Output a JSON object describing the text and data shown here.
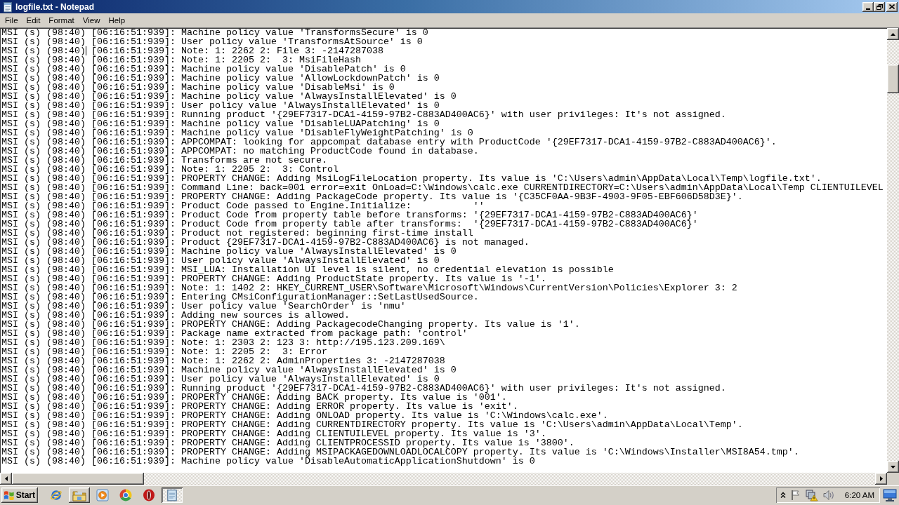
{
  "window": {
    "title": "logfile.txt - Notepad"
  },
  "menu": [
    "File",
    "Edit",
    "Format",
    "View",
    "Help"
  ],
  "editor": {
    "lines": [
      {
        "text": "MSI (s) (98:40) [06:16:51:939]: Machine policy value 'TransformsSecure' is 0",
        "caret": false
      },
      {
        "text": "MSI (s) (98:40) [06:16:51:939]: User policy value 'TransformsAtSource' is 0",
        "caret": false
      },
      {
        "text": "MSI (s) (98:40) [06:16:51:939]: Note: 1: 2262 2: File 3: -2147287038",
        "caret": true
      },
      {
        "text": "MSI (s) (98:40) [06:16:51:939]: Note: 1: 2205 2:  3: MsiFileHash",
        "caret": false
      },
      {
        "text": "MSI (s) (98:40) [06:16:51:939]: Machine policy value 'DisablePatch' is 0",
        "caret": false
      },
      {
        "text": "MSI (s) (98:40) [06:16:51:939]: Machine policy value 'AllowLockdownPatch' is 0",
        "caret": false
      },
      {
        "text": "MSI (s) (98:40) [06:16:51:939]: Machine policy value 'DisableMsi' is 0",
        "caret": false
      },
      {
        "text": "MSI (s) (98:40) [06:16:51:939]: Machine policy value 'AlwaysInstallElevated' is 0",
        "caret": false
      },
      {
        "text": "MSI (s) (98:40) [06:16:51:939]: User policy value 'AlwaysInstallElevated' is 0",
        "caret": false
      },
      {
        "text": "MSI (s) (98:40) [06:16:51:939]: Running product '{29EF7317-DCA1-4159-97B2-C883AD400AC6}' with user privileges: It's not assigned.",
        "caret": false
      },
      {
        "text": "MSI (s) (98:40) [06:16:51:939]: Machine policy value 'DisableLUAPatching' is 0",
        "caret": false
      },
      {
        "text": "MSI (s) (98:40) [06:16:51:939]: Machine policy value 'DisableFlyWeightPatching' is 0",
        "caret": false
      },
      {
        "text": "MSI (s) (98:40) [06:16:51:939]: APPCOMPAT: looking for appcompat database entry with ProductCode '{29EF7317-DCA1-4159-97B2-C883AD400AC6}'.",
        "caret": false
      },
      {
        "text": "MSI (s) (98:40) [06:16:51:939]: APPCOMPAT: no matching ProductCode found in database.",
        "caret": false
      },
      {
        "text": "MSI (s) (98:40) [06:16:51:939]: Transforms are not secure.",
        "caret": false
      },
      {
        "text": "MSI (s) (98:40) [06:16:51:939]: Note: 1: 2205 2:  3: Control",
        "caret": false
      },
      {
        "text": "MSI (s) (98:40) [06:16:51:939]: PROPERTY CHANGE: Adding MsiLogFileLocation property. Its value is 'C:\\Users\\admin\\AppData\\Local\\Temp\\logfile.txt'.",
        "caret": false
      },
      {
        "text": "MSI (s) (98:40) [06:16:51:939]: Command Line: back=001 error=exit OnLoad=C:\\Windows\\calc.exe CURRENTDIRECTORY=C:\\Users\\admin\\AppData\\Local\\Temp CLIENTUILEVEL",
        "caret": false
      },
      {
        "text": "MSI (s) (98:40) [06:16:51:939]: PROPERTY CHANGE: Adding PackageCode property. Its value is '{C35CF0AA-9B3F-4903-9F05-EBF606D58D3E}'.",
        "caret": false
      },
      {
        "text": "MSI (s) (98:40) [06:16:51:939]: Product Code passed to Engine.Initialize:           ''",
        "caret": false
      },
      {
        "text": "MSI (s) (98:40) [06:16:51:939]: Product Code from property table before transforms: '{29EF7317-DCA1-4159-97B2-C883AD400AC6}'",
        "caret": false
      },
      {
        "text": "MSI (s) (98:40) [06:16:51:939]: Product Code from property table after transforms:  '{29EF7317-DCA1-4159-97B2-C883AD400AC6}'",
        "caret": false
      },
      {
        "text": "MSI (s) (98:40) [06:16:51:939]: Product not registered: beginning first-time install",
        "caret": false
      },
      {
        "text": "MSI (s) (98:40) [06:16:51:939]: Product {29EF7317-DCA1-4159-97B2-C883AD400AC6} is not managed.",
        "caret": false
      },
      {
        "text": "MSI (s) (98:40) [06:16:51:939]: Machine policy value 'AlwaysInstallElevated' is 0",
        "caret": false
      },
      {
        "text": "MSI (s) (98:40) [06:16:51:939]: User policy value 'AlwaysInstallElevated' is 0",
        "caret": false
      },
      {
        "text": "MSI (s) (98:40) [06:16:51:939]: MSI_LUA: Installation UI level is silent, no credential elevation is possible",
        "caret": false
      },
      {
        "text": "MSI (s) (98:40) [06:16:51:939]: PROPERTY CHANGE: Adding ProductState property. Its value is '-1'.",
        "caret": false
      },
      {
        "text": "MSI (s) (98:40) [06:16:51:939]: Note: 1: 1402 2: HKEY_CURRENT_USER\\Software\\Microsoft\\Windows\\CurrentVersion\\Policies\\Explorer 3: 2",
        "caret": false
      },
      {
        "text": "MSI (s) (98:40) [06:16:51:939]: Entering CMsiConfigurationManager::SetLastUsedSource.",
        "caret": false
      },
      {
        "text": "MSI (s) (98:40) [06:16:51:939]: User policy value 'SearchOrder' is 'nmu'",
        "caret": false
      },
      {
        "text": "MSI (s) (98:40) [06:16:51:939]: Adding new sources is allowed.",
        "caret": false
      },
      {
        "text": "MSI (s) (98:40) [06:16:51:939]: PROPERTY CHANGE: Adding PackagecodeChanging property. Its value is '1'.",
        "caret": false
      },
      {
        "text": "MSI (s) (98:40) [06:16:51:939]: Package name extracted from package path: 'control'",
        "caret": false
      },
      {
        "text": "MSI (s) (98:40) [06:16:51:939]: Note: 1: 2303 2: 123 3: http://195.123.209.169\\",
        "caret": false
      },
      {
        "text": "MSI (s) (98:40) [06:16:51:939]: Note: 1: 2205 2:  3: Error",
        "caret": false
      },
      {
        "text": "MSI (s) (98:40) [06:16:51:939]: Note: 1: 2262 2: AdminProperties 3: -2147287038",
        "caret": false
      },
      {
        "text": "MSI (s) (98:40) [06:16:51:939]: Machine policy value 'AlwaysInstallElevated' is 0",
        "caret": false
      },
      {
        "text": "MSI (s) (98:40) [06:16:51:939]: User policy value 'AlwaysInstallElevated' is 0",
        "caret": false
      },
      {
        "text": "MSI (s) (98:40) [06:16:51:939]: Running product '{29EF7317-DCA1-4159-97B2-C883AD400AC6}' with user privileges: It's not assigned.",
        "caret": false
      },
      {
        "text": "MSI (s) (98:40) [06:16:51:939]: PROPERTY CHANGE: Adding BACK property. Its value is '001'.",
        "caret": false
      },
      {
        "text": "MSI (s) (98:40) [06:16:51:939]: PROPERTY CHANGE: Adding ERROR property. Its value is 'exit'.",
        "caret": false
      },
      {
        "text": "MSI (s) (98:40) [06:16:51:939]: PROPERTY CHANGE: Adding ONLOAD property. Its value is 'C:\\Windows\\calc.exe'.",
        "caret": false
      },
      {
        "text": "MSI (s) (98:40) [06:16:51:939]: PROPERTY CHANGE: Adding CURRENTDIRECTORY property. Its value is 'C:\\Users\\admin\\AppData\\Local\\Temp'.",
        "caret": false
      },
      {
        "text": "MSI (s) (98:40) [06:16:51:939]: PROPERTY CHANGE: Adding CLIENTUILEVEL property. Its value is '3'.",
        "caret": false
      },
      {
        "text": "MSI (s) (98:40) [06:16:51:939]: PROPERTY CHANGE: Adding CLIENTPROCESSID property. Its value is '3800'.",
        "caret": false
      },
      {
        "text": "MSI (s) (98:40) [06:16:51:939]: PROPERTY CHANGE: Adding MSIPACKAGEDOWNLOADLOCALCOPY property. Its value is 'C:\\Windows\\Installer\\MSI8A54.tmp'.",
        "caret": false
      },
      {
        "text": "MSI (s) (98:40) [06:16:51:939]: Machine policy value 'DisableAutomaticApplicationShutdown' is 0",
        "caret": false
      }
    ]
  },
  "taskbar": {
    "start": "Start",
    "items": [
      {
        "kind": "browser",
        "running": false,
        "selected": false
      },
      {
        "kind": "folder",
        "running": true,
        "selected": false
      },
      {
        "kind": "player",
        "running": false,
        "selected": false
      },
      {
        "kind": "orb",
        "running": false,
        "selected": false
      },
      {
        "kind": "disc",
        "running": false,
        "selected": false
      },
      {
        "kind": "notepad",
        "running": true,
        "selected": true
      }
    ],
    "clock": "6:20 AM"
  }
}
